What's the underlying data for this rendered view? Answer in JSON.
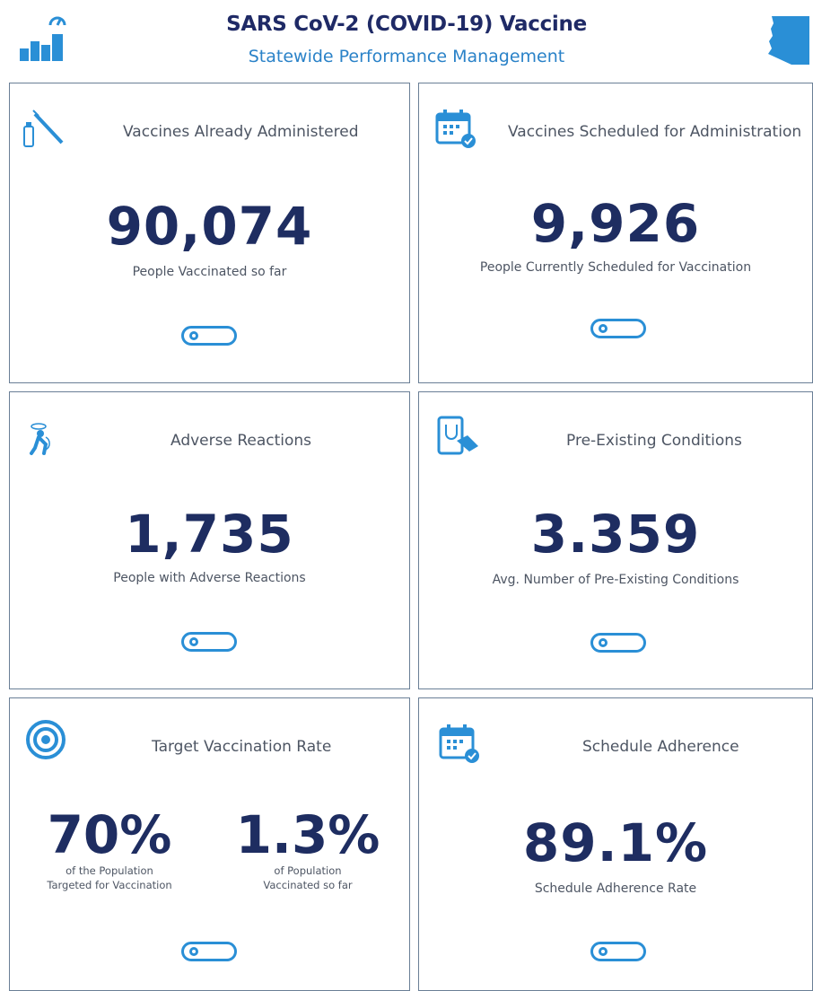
{
  "header": {
    "title": "SARS CoV-2 (COVID-19) Vaccine",
    "subtitle": "Statewide Performance Management",
    "logo_icon": "performance-chart-icon",
    "state_icon": "arizona-state-icon"
  },
  "colors": {
    "navy": "#1e2d61",
    "blue_accent": "#2a8fd6",
    "subtitle_blue": "#2a82c8",
    "border": "#6a7f96"
  },
  "cards": {
    "administered": {
      "label": "Vaccines Already Administered",
      "value": "90,074",
      "desc": "People Vaccinated so far",
      "icon": "syringe-vial-icon"
    },
    "scheduled": {
      "label": "Vaccines Scheduled for Administration",
      "value": "9,926",
      "desc": "People Currently Scheduled for Vaccination",
      "icon": "calendar-check-icon"
    },
    "adverse": {
      "label": "Adverse Reactions",
      "value": "1,735",
      "desc": "People with Adverse Reactions",
      "icon": "dizzy-person-icon"
    },
    "preexisting": {
      "label": "Pre-Existing Conditions",
      "value": "3.359",
      "desc": "Avg. Number of Pre-Existing Conditions",
      "icon": "tablet-stethoscope-icon"
    },
    "target": {
      "label": "Target Vaccination Rate",
      "icon": "target-icon",
      "left_value": "70%",
      "left_desc_1": "of the Population",
      "left_desc_2": "Targeted for Vaccination",
      "right_value": "1.3%",
      "right_desc_1": "of Population",
      "right_desc_2": "Vaccinated so far"
    },
    "adherence": {
      "label": "Schedule Adherence",
      "value": "89.1%",
      "desc": "Schedule Adherence Rate",
      "icon": "calendar-check-icon"
    }
  }
}
